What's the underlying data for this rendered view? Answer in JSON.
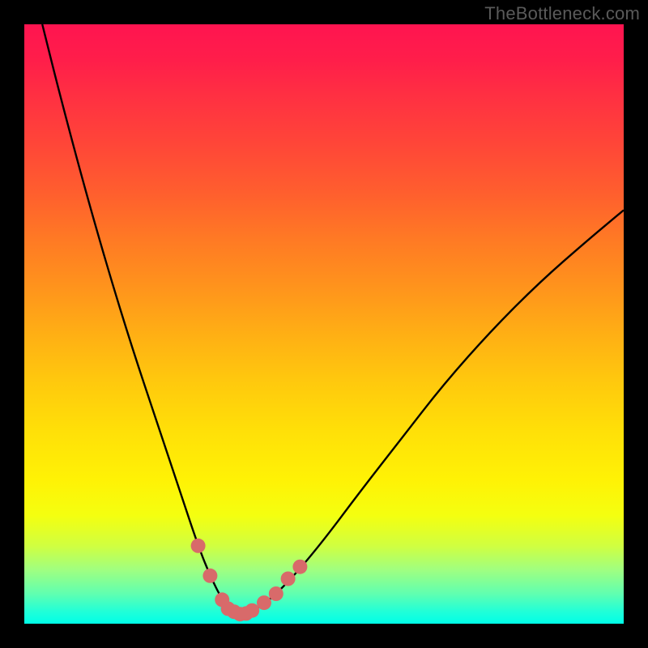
{
  "watermark": "TheBottleneck.com",
  "chart_data": {
    "type": "line",
    "title": "",
    "xlabel": "",
    "ylabel": "",
    "xlim": [
      0,
      100
    ],
    "ylim": [
      0,
      100
    ],
    "series": [
      {
        "name": "bottleneck-curve",
        "x": [
          3,
          6,
          10,
          14,
          18,
          22,
          26,
          29,
          31,
          33,
          34.5,
          36,
          38,
          41,
          45,
          50,
          56,
          63,
          70,
          78,
          86,
          94,
          100
        ],
        "y": [
          100,
          88,
          73,
          59,
          46,
          34,
          22,
          13,
          8,
          4,
          2,
          1.5,
          2,
          4,
          8,
          14,
          22,
          31,
          40,
          49,
          57,
          64,
          69
        ]
      }
    ],
    "markers": {
      "name": "highlight-dots",
      "points": [
        {
          "x": 29,
          "y": 13
        },
        {
          "x": 31,
          "y": 8
        },
        {
          "x": 33,
          "y": 4
        },
        {
          "x": 34,
          "y": 2.5
        },
        {
          "x": 35,
          "y": 2
        },
        {
          "x": 36,
          "y": 1.6
        },
        {
          "x": 37,
          "y": 1.7
        },
        {
          "x": 38,
          "y": 2.2
        },
        {
          "x": 40,
          "y": 3.5
        },
        {
          "x": 42,
          "y": 5
        },
        {
          "x": 44,
          "y": 7.5
        },
        {
          "x": 46,
          "y": 9.5
        }
      ]
    },
    "colors": {
      "curve": "#000000",
      "markers": "#d86a6a",
      "gradient_top": "#ff1450",
      "gradient_bottom": "#00ffe8"
    }
  }
}
